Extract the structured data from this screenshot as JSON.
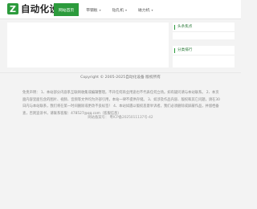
{
  "header": {
    "logo_letter": "Z",
    "site_name": "自动化设备",
    "nav": [
      {
        "label": "网站首页",
        "has_dropdown": false,
        "active": true
      },
      {
        "label": "带钢板",
        "has_dropdown": true,
        "active": false
      },
      {
        "label": "钻孔机",
        "has_dropdown": true,
        "active": false
      },
      {
        "label": "磁力机",
        "has_dropdown": true,
        "active": false
      }
    ],
    "caret_icon": "▾"
  },
  "sidebar": {
    "box1_title": "头条焦点",
    "box2_title": "分类排行"
  },
  "footer": {
    "copyright": "Copyright © 2005-2025自动化设备 版权所有",
    "disclaimer": "免责声明： 1、本站部分内容系互联网收集或编辑整理。不开任何商业用途也不代表任何立场。如有疑问请与本站联系。 2、本页面内容里面包含的图片、视频、音频等文件均为外部引用，本站一律不提供存储。 3、如涉及作品内容、版权和其它问题，请在30日内与本站联系，我们将在第一时间删除或更改不良标签！ 4、本站如遇以版权恶意举诉者，我们必须删除或屏蔽作品，并留档备查，否则追诉书，请联系客服：478527@qq.com（客服信息）",
    "beian": "网站备案号：  粤ICP备2025011137号-42"
  },
  "colors": {
    "brand": "#2c9b3c",
    "page_bg": "#f3f3f3"
  }
}
